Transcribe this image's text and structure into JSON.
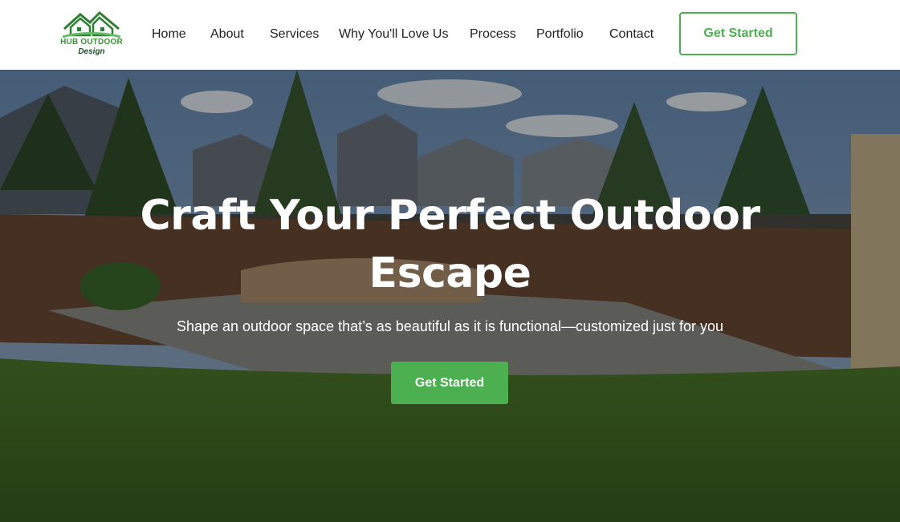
{
  "brand": {
    "line1": "HUB OUTDOOR",
    "line2": "Design",
    "logo_icon": "house-roof-logo-icon",
    "colors": {
      "primary": "#3f8f3a",
      "dark": "#1f4d2a"
    }
  },
  "nav": {
    "items": [
      {
        "label": "Home"
      },
      {
        "label": "About"
      },
      {
        "label": "Services"
      },
      {
        "label": "Why You'll Love Us"
      },
      {
        "label": "Process"
      },
      {
        "label": "Portfolio"
      },
      {
        "label": "Contact"
      }
    ],
    "cta_label": "Get Started"
  },
  "hero": {
    "title": "Craft Your Perfect Outdoor Escape",
    "subtitle": "Shape an outdoor space that’s as beautiful as it is functional—customized just for you",
    "cta_label": "Get Started",
    "background": "backyard-landscape-photo"
  },
  "colors": {
    "accent": "#4caf50",
    "text": "#222222",
    "hero_text": "#ffffff"
  }
}
